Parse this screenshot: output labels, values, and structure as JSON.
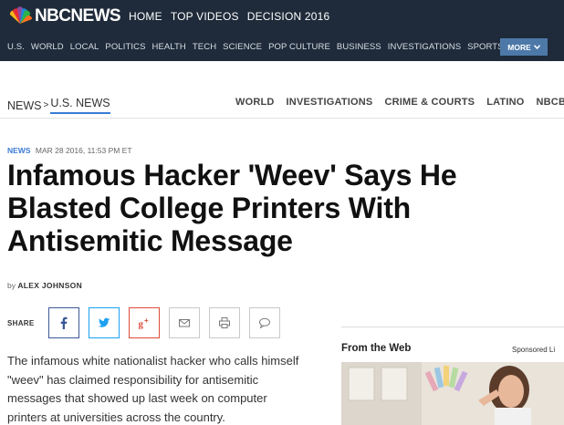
{
  "brand": {
    "logo_prefix": "NBC",
    "logo_suffix": "NEWS"
  },
  "primary_nav": [
    "HOME",
    "TOP VIDEOS",
    "DECISION 2016"
  ],
  "secondary_nav": [
    "U.S.",
    "WORLD",
    "LOCAL",
    "POLITICS",
    "HEALTH",
    "TECH",
    "SCIENCE",
    "POP CULTURE",
    "BUSINESS",
    "INVESTIGATIONS",
    "SPORTS"
  ],
  "more_button": {
    "label": "MORE",
    "icon": "chevron-down-icon"
  },
  "breadcrumb": {
    "root": "NEWS",
    "separator": ">",
    "current": "U.S. NEWS"
  },
  "section_tabs": [
    "WORLD",
    "INVESTIGATIONS",
    "CRIME & COURTS",
    "LATINO",
    "NBCBLK"
  ],
  "article": {
    "label": "NEWS",
    "timestamp": "MAR 28 2016, 11:53 PM ET",
    "headline_lines": [
      "Infamous Hacker 'Weev' Says He",
      "Blasted College Printers With",
      "Antisemitic Message"
    ],
    "byline_prefix": "by",
    "author": "ALEX JOHNSON",
    "body": "The infamous white nationalist hacker who calls himself \"weev\" has claimed responsibility for antisemitic messages that showed up last week on computer printers at universities across the country."
  },
  "share": {
    "label": "SHARE",
    "buttons": [
      {
        "name": "facebook",
        "icon": "facebook-icon"
      },
      {
        "name": "twitter",
        "icon": "twitter-icon"
      },
      {
        "name": "google-plus",
        "icon": "google-plus-icon"
      },
      {
        "name": "email",
        "icon": "email-icon"
      },
      {
        "name": "print",
        "icon": "print-icon"
      },
      {
        "name": "comment",
        "icon": "comment-icon"
      }
    ]
  },
  "sidebar": {
    "heading": "From the Web",
    "sponsored": "Sponsored Li"
  },
  "colors": {
    "topbar": "#1f2b3a",
    "accent": "#3a7bd5",
    "more_button": "#4d79a8"
  }
}
